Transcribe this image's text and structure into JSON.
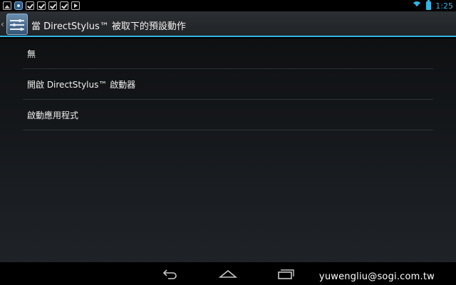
{
  "status_bar": {
    "notification_icons": [
      "picture-icon",
      "app-icon",
      "check-icon",
      "check-icon",
      "check-icon",
      "check-icon",
      "play-icon"
    ],
    "time": "1:25",
    "accent_color": "#33b5e5"
  },
  "action_bar": {
    "icon": "settings-sliders-icon",
    "title": "當 DirectStylus™ 被取下的預設動作"
  },
  "options": [
    {
      "label": "無"
    },
    {
      "label": "開啟 DirectStylus™ 啟動器"
    },
    {
      "label": "啟動應用程式"
    }
  ],
  "nav_bar": {
    "buttons": [
      "back-icon",
      "home-icon",
      "recent-apps-icon"
    ]
  },
  "watermark": "yuwengliu@sogi.com.tw"
}
